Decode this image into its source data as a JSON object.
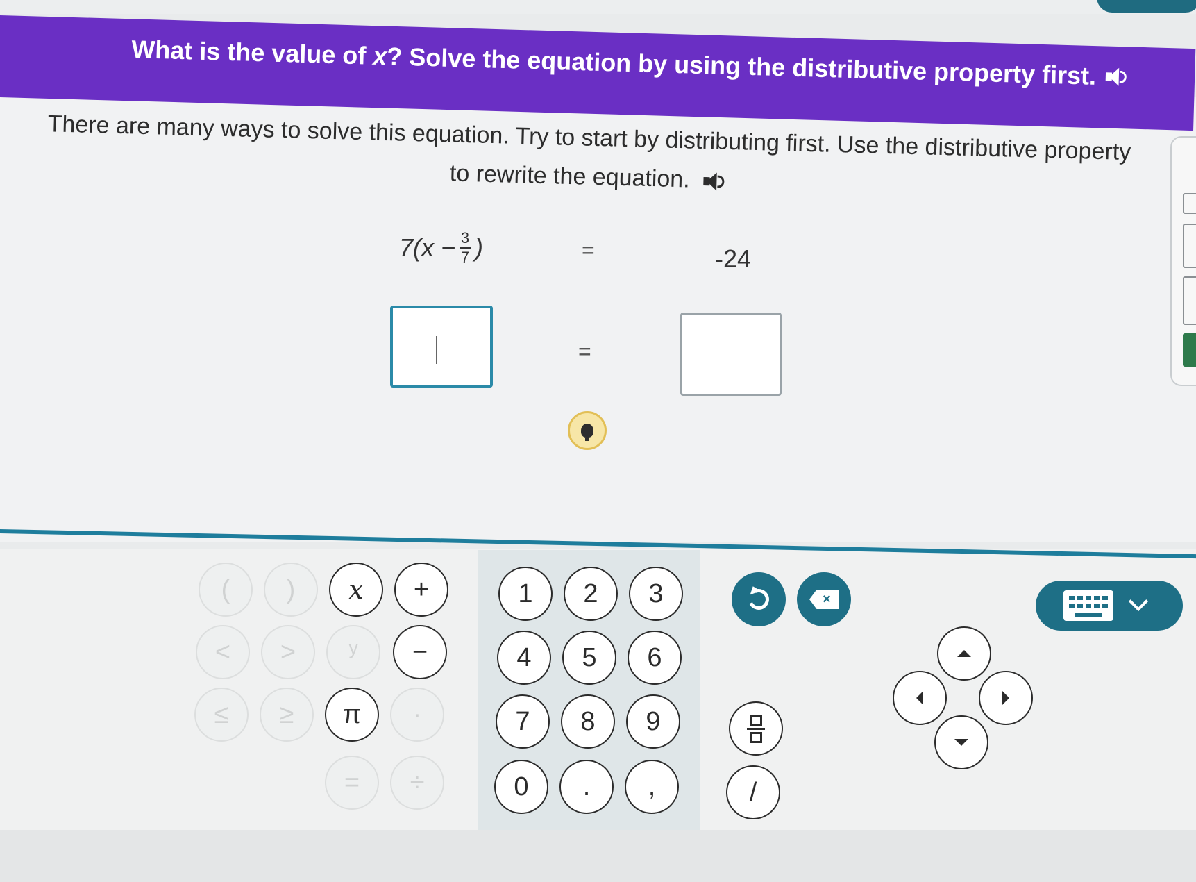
{
  "banner": {
    "question_prefix": "What is the value of ",
    "question_var": "x",
    "question_suffix": "? Solve the equation by using the distributive property first."
  },
  "instructions": {
    "text": "There are many ways to solve this equation. Try to start by distributing first. Use the distributive property to rewrite the equation."
  },
  "equation": {
    "left_coef": "7",
    "left_open": "(x −",
    "frac_num": "3",
    "frac_den": "7",
    "left_close": ")",
    "equals": "=",
    "right": "-24"
  },
  "answer_row": {
    "equals": "=",
    "left_value": "",
    "right_value": ""
  },
  "keypad": {
    "symbols": {
      "lparen": "(",
      "rparen": ")",
      "x": "x",
      "plus": "+",
      "lt": "<",
      "gt": ">",
      "power": "ʸ",
      "minus": "−",
      "le": "≤",
      "ge": "≥",
      "pi": "π",
      "dot_op": "·",
      "eq": "=",
      "div": "÷"
    },
    "digits": [
      "1",
      "2",
      "3",
      "4",
      "5",
      "6",
      "7",
      "8",
      "9",
      "0"
    ],
    "decimal": ".",
    "comma": ",",
    "slash": "/",
    "delete_label": "×"
  },
  "icons": {
    "speaker": "speaker-icon",
    "hint": "lightbulb-icon",
    "undo": "undo-icon",
    "delete": "backspace-icon",
    "keyboard": "keyboard-icon",
    "fraction": "fraction-icon"
  },
  "colors": {
    "banner": "#6a2fc4",
    "accent": "#1e6f86",
    "hint": "#f7e6a7"
  }
}
